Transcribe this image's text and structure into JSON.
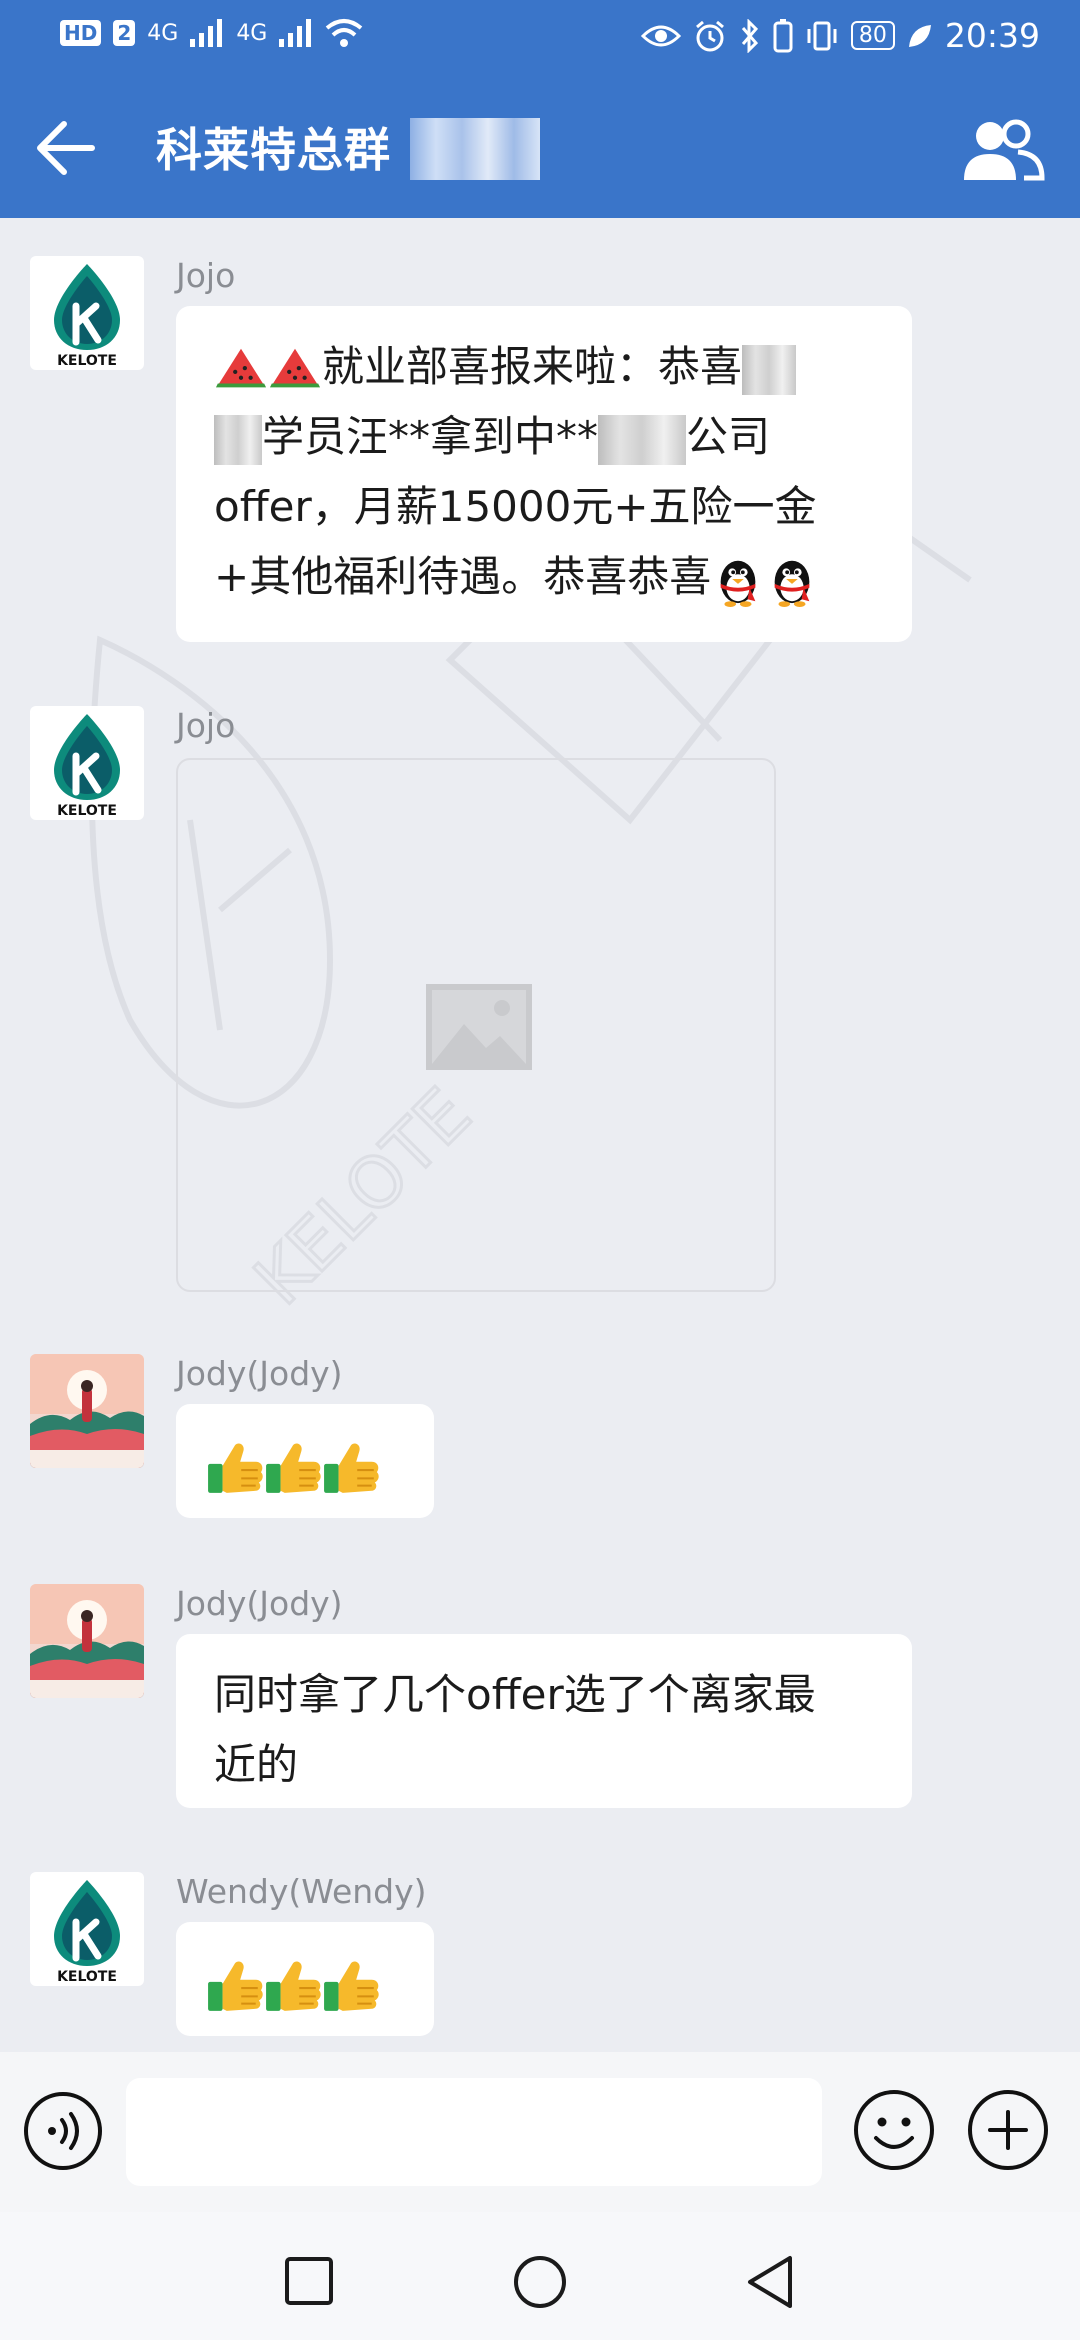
{
  "status_bar": {
    "hd": "HD",
    "sim2": "2",
    "signal_1": "4G",
    "signal_2": "4G",
    "battery": "80",
    "time": "20:39"
  },
  "header": {
    "title": "科莱特总群",
    "back_icon": "arrow-left-icon",
    "members_icon": "group-members-icon",
    "bar_color": "#3a75c9"
  },
  "messages": [
    {
      "sender": "Jojo",
      "avatar": "kelote-logo",
      "avatar_text": "KELOTE",
      "type": "text",
      "line1": "就业部喜报来啦：恭喜",
      "line2a": "学员汪**拿到中**",
      "line2b": "公司",
      "line3": "offer，月薪15000元+五险一金",
      "line4": "+其他福利待遇。恭喜恭喜"
    },
    {
      "sender": "Jojo",
      "avatar": "kelote-logo",
      "avatar_text": "KELOTE",
      "type": "image"
    },
    {
      "sender": "Jody(Jody)",
      "avatar": "sunset-girl-avatar",
      "type": "emoji",
      "content": "thumbs-up ×3"
    },
    {
      "sender": "Jody(Jody)",
      "avatar": "sunset-girl-avatar",
      "type": "text",
      "line1": "同时拿了几个offer选了个离家最",
      "line2": "近的"
    },
    {
      "sender": "Wendy(Wendy)",
      "avatar": "kelote-logo",
      "avatar_text": "KELOTE",
      "type": "emoji",
      "content": "thumbs-up ×3"
    }
  ],
  "watermark": {
    "text": "KELOTE"
  },
  "input_bar": {
    "placeholder": "",
    "voice_icon": "voice-icon",
    "emoji_icon": "smiley-icon",
    "plus_icon": "plus-icon"
  },
  "nav_bar": {
    "recent_icon": "recent-apps-icon",
    "home_icon": "home-icon",
    "back_icon": "back-triangle-icon"
  }
}
